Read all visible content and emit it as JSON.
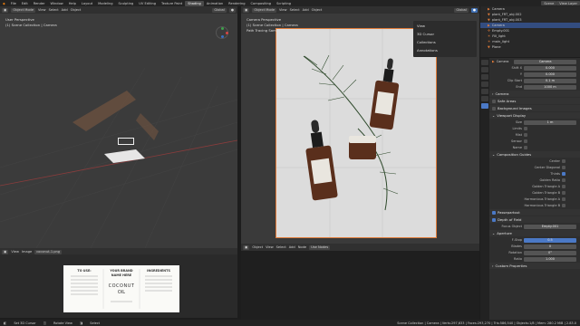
{
  "menubar": {
    "items": [
      "File",
      "Edit",
      "Render",
      "Window",
      "Help"
    ],
    "workspaces": [
      "Layout",
      "Modeling",
      "Sculpting",
      "UV Editing",
      "Texture Paint",
      "Shading",
      "Animation",
      "Rendering",
      "Compositing",
      "Scripting"
    ],
    "active_workspace": "Shading",
    "scene": "Scene",
    "view_layer": "View Layer"
  },
  "viewport_left": {
    "header": {
      "mode": "Object Mode",
      "view": "View",
      "select": "Select",
      "add": "Add",
      "object": "Object",
      "transform": "Global"
    },
    "info_line1": "User Perspective",
    "info_line2": "(1) Scene Collection | Camera"
  },
  "viewport_right": {
    "header": {
      "mode": "Object Mode",
      "view": "View",
      "select": "Select",
      "add": "Add",
      "object": "Object",
      "transform": "Global"
    },
    "info_line1": "Camera Perspective",
    "info_line2": "(1) Scene Collection | Camera",
    "info_line3": "Path Tracing Sample 1/1",
    "overlay_menu": [
      "View",
      "3D Cursor",
      "Collections",
      "Annotations"
    ]
  },
  "node_editor": {
    "header": {
      "object": "Object",
      "view": "View",
      "select": "Select",
      "add": "Add",
      "node": "Node",
      "use_nodes": "Use Nodes"
    }
  },
  "image_editor": {
    "header": {
      "view": "View",
      "image": "Image",
      "name": "coconut-1.png"
    },
    "card": {
      "col1_title": "TO USE:",
      "col2_brand1": "YOUR BRAND",
      "col2_brand2": "NAME HERE",
      "col2_product1": "COCONUT",
      "col2_product2": "OIL",
      "col3_title": "INGREDIENTS"
    }
  },
  "outliner": {
    "items": [
      {
        "name": "Camera",
        "selected": false
      },
      {
        "name": "plant_FRT_obj.002",
        "selected": false
      },
      {
        "name": "plant_FRT_obj.003",
        "selected": false
      },
      {
        "name": "Camera",
        "selected": true
      },
      {
        "name": "Empty.001",
        "selected": false
      },
      {
        "name": "Fill_light",
        "selected": false
      },
      {
        "name": "main_light",
        "selected": false
      },
      {
        "name": "Plane",
        "selected": false
      }
    ]
  },
  "properties": {
    "object_name": "Camera",
    "data_name": "Camera",
    "lens_rows": [
      {
        "label": "Shift X",
        "value": "0.000"
      },
      {
        "label": "Y",
        "value": "0.000"
      },
      {
        "label": "Clip Start",
        "value": "0.1 m"
      },
      {
        "label": "End",
        "value": "1000 m"
      }
    ],
    "sections": {
      "camera": "Camera",
      "safe_areas": "Safe Areas",
      "background_images": "Background Images",
      "viewport_display": "Viewport Display",
      "size_label": "Size",
      "size_value": "1 m",
      "limits": "Limits",
      "mist": "Mist",
      "sensor": "Sensor",
      "name": "Name",
      "composition_guides": "Composition Guides",
      "guides": [
        "Center",
        "Center Diagonal",
        "Thirds",
        "Golden Ratio",
        "Golden Triangle A",
        "Golden Triangle B",
        "Harmonious Triangle A",
        "Harmonious Triangle B"
      ],
      "passepartout": "Passepartout",
      "depth_of_field": "Depth of Field",
      "focus_object_label": "Focus Object",
      "focus_object_value": "Empty.001",
      "aperture": "Aperture",
      "fstop_label": "F-Stop",
      "fstop_value": "0.5",
      "blades_label": "Blades",
      "blades_value": "0",
      "rotation_label": "Rotation",
      "rotation_value": "0°",
      "ratio_label": "Ratio",
      "ratio_value": "1.000",
      "custom_properties": "Custom Properties"
    }
  },
  "status_bar": {
    "left": "Set 3D Cursor",
    "mid": "Rotate View",
    "right": "Select",
    "stats": "Scene Collection | Camera | Verts:297,633 | Faces:293,270 | Tris:586,540 | Objects:1/8 | Mem: 280.2 MiB | 2.83.0"
  },
  "colors": {
    "accent": "#3f6fb3",
    "selected_row": "#334d80",
    "viewport_bg": "#3b3b3b",
    "camera_bg": "#dcdcdc"
  }
}
